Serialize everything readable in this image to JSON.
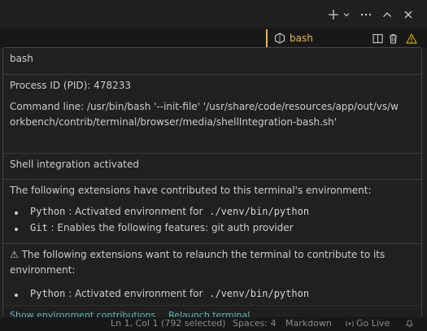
{
  "tab": {
    "label": "bash"
  },
  "hover": {
    "title": "bash",
    "pid": "Process ID (PID): 478233",
    "cmdline": "Command line: /usr/bin/bash '--init-file' '/usr/share/code/resources/app/out/vs/workbench/contrib/terminal/browser/media/shellIntegration-bash.sh'",
    "shell_integration": "Shell integration activated",
    "contrib_heading": "The following extensions have contributed to this terminal's environment:",
    "contrib_items": [
      {
        "name": "Python",
        "desc": ": Activated environment for",
        "code": "./venv/bin/python"
      },
      {
        "name": "Git",
        "desc": ": Enables the following features: git auth provider",
        "code": ""
      }
    ],
    "relaunch_heading": "⚠ The following extensions want to relaunch the terminal to contribute to its environment:",
    "relaunch_items": [
      {
        "name": "Python",
        "desc": ": Activated environment for",
        "code": "./venv/bin/python"
      }
    ],
    "links": [
      "Show environment contributions",
      "Relaunch terminal"
    ]
  },
  "status": {
    "position": "Ln 1, Col 1 (792 selected)",
    "spaces": "Spaces: 4",
    "language": "Markdown",
    "golive": "Go Live"
  },
  "colors": {
    "accent": "#e8b84a",
    "link": "#5fb8b8",
    "warning": "#cca700"
  }
}
